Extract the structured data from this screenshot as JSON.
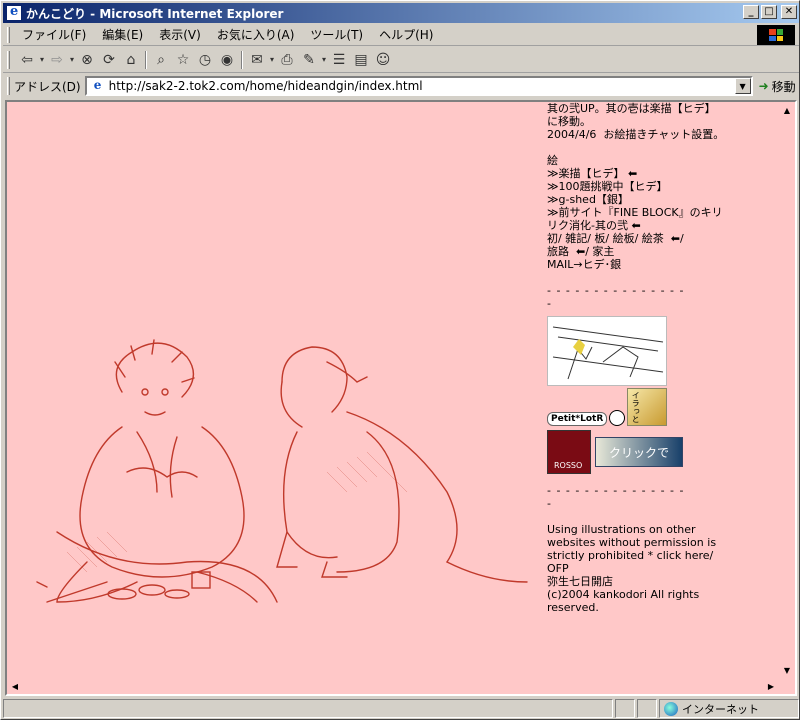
{
  "window": {
    "title": "かんこどり - Microsoft Internet Explorer"
  },
  "menu": [
    "ファイル(F)",
    "編集(E)",
    "表示(V)",
    "お気に入り(A)",
    "ツール(T)",
    "ヘルプ(H)"
  ],
  "address": {
    "label": "アドレス(D)",
    "url": "http://sak2-2.tok2.com/home/hideandgin/index.html",
    "go_label": "移動"
  },
  "sidebar": {
    "lines_top": "其の弐UP。其の壱は楽描【ヒデ】\nに移動。\n2004/4/6  お絵描きチャット設置。",
    "menu_title": "絵",
    "menu_items": "≫楽描【ヒデ】 ⬅\n≫100題挑戦中【ヒデ】\n≫g-shed【銀】\n≫前サイト『FINE BLOCK』のキリ\nリク消化-其の弐 ⬅\n初/ 雑記/ 板/ 絵板/ 絵茶  ⬅/\n旅路  ⬅/ 家主\nMAIL→ヒデ･銀",
    "dash1": "- - - - - - - - - - - - - - -\n-",
    "petit": "Petit*LotR",
    "irasto": "イラっと",
    "rosso": "ROSSO",
    "click": "クリックで",
    "dash2": "- - - - - - - - - - - - - - -\n-",
    "footer": "Using illustrations on other\nwebsites without permission is\nstrictly prohibited * click here/\nOFP\n弥生七日開店\n(c)2004 kankodori All rights\nreserved."
  },
  "status": {
    "zone": "インターネット"
  },
  "colors": {
    "page_bg": "#ffc8c8",
    "sketch": "#c0392b",
    "titlebar_start": "#0a246a",
    "titlebar_end": "#a6caf0"
  },
  "icons": [
    "back-icon",
    "forward-icon",
    "stop-icon",
    "refresh-icon",
    "home-icon",
    "search-icon",
    "favorites-icon",
    "history-icon",
    "media-icon",
    "mail-icon",
    "print-icon",
    "edit-icon",
    "discuss-icon",
    "messenger-icon"
  ]
}
